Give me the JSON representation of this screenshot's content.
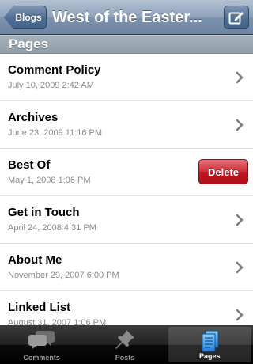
{
  "navbar": {
    "back_label": "Blogs",
    "title": "West of the Easter...",
    "compose_icon": "compose-icon"
  },
  "section": {
    "title": "Pages"
  },
  "pages": [
    {
      "title": "Comment Policy",
      "date": "July 10, 2009 2:42 AM",
      "accessory": "chevron"
    },
    {
      "title": "Archives",
      "date": "June 23, 2009 11:16 PM",
      "accessory": "chevron"
    },
    {
      "title": "Best Of",
      "date": "May 1, 2008 1:06 PM",
      "accessory": "delete"
    },
    {
      "title": "Get in Touch",
      "date": "April 24, 2008 4:31 PM",
      "accessory": "chevron"
    },
    {
      "title": "About Me",
      "date": "November 29, 2007 6:00 PM",
      "accessory": "chevron"
    },
    {
      "title": "Linked List",
      "date": "August 31, 2007 1:06 PM",
      "accessory": "chevron"
    }
  ],
  "delete_label": "Delete",
  "tabbar": {
    "tabs": [
      {
        "label": "Comments",
        "icon": "comments-icon",
        "selected": false
      },
      {
        "label": "Posts",
        "icon": "pushpin-icon",
        "selected": false
      },
      {
        "label": "Pages",
        "icon": "pages-icon",
        "selected": true
      }
    ]
  },
  "colors": {
    "delete": "#cf2d36",
    "navbar": "#6d85a2",
    "subtitle": "#8c8c8c"
  }
}
